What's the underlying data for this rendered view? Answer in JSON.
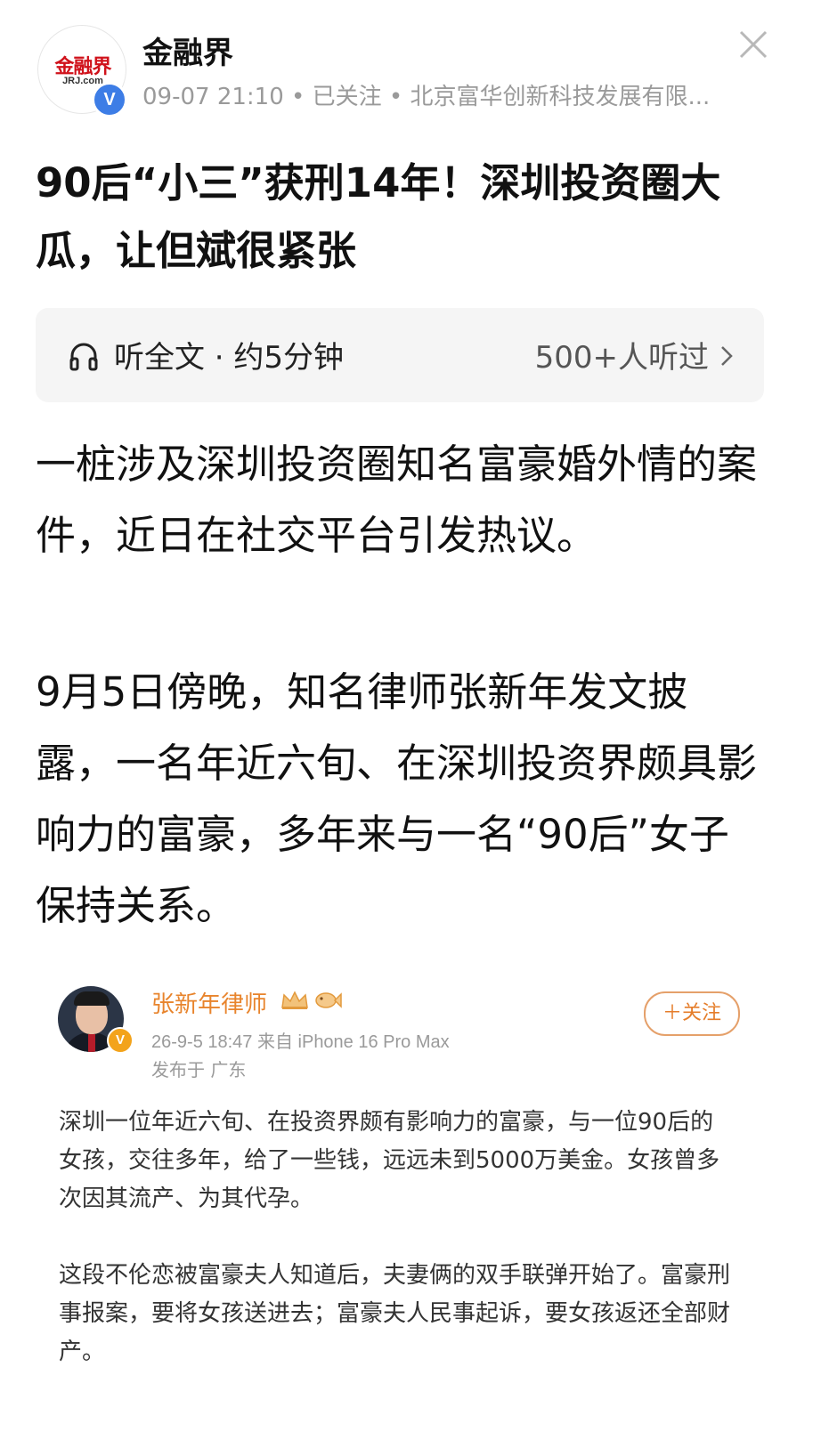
{
  "header": {
    "logo_text": "金融界",
    "logo_sub": "JRJ.com",
    "verified_mark": "V",
    "account_name": "金融界",
    "meta": "09-07 21:10 • 已关注 • 北京富华创新科技发展有限..."
  },
  "article": {
    "title": "90后“小三”获刑14年！深圳投资圈大瓜，让但斌很紧张",
    "listen": {
      "label": "听全文 · 约5分钟",
      "count": "500+人听过"
    },
    "paragraphs": [
      "一桩涉及深圳投资圈知名富豪婚外情的案件，近日在社交平台引发热议。",
      "9月5日傍晚，知名律师张新年发文披露，一名年近六旬、在深圳投资界颇具影响力的富豪，多年来与一名“90后”女子保持关系。"
    ]
  },
  "embed": {
    "author": "张新年律师",
    "badge_mark": "V",
    "time_source": "26-9-5 18:47  来自 iPhone 16 Pro Max",
    "location": "发布于 广东",
    "follow_label": "＋关注",
    "paragraphs": [
      "深圳一位年近六旬、在投资界颇有影响力的富豪，与一位90后的女孩，交往多年，给了一些钱，远远未到5000万美金。女孩曾多次因其流产、为其代孕。",
      "这段不伦恋被富豪夫人知道后，夫妻俩的双手联弹开始了。富豪刑事报案，要将女孩送进去；富豪夫人民事起诉，要女孩返还全部财产。"
    ]
  },
  "colors": {
    "brand_red": "#d0121b",
    "verified_blue": "#3d7de6",
    "embed_orange": "#e8842c",
    "meta_gray": "#9a9a9a"
  },
  "icons": [
    "close-icon",
    "headphones-icon",
    "chevron-right-icon",
    "crown-icon",
    "fish-icon"
  ]
}
